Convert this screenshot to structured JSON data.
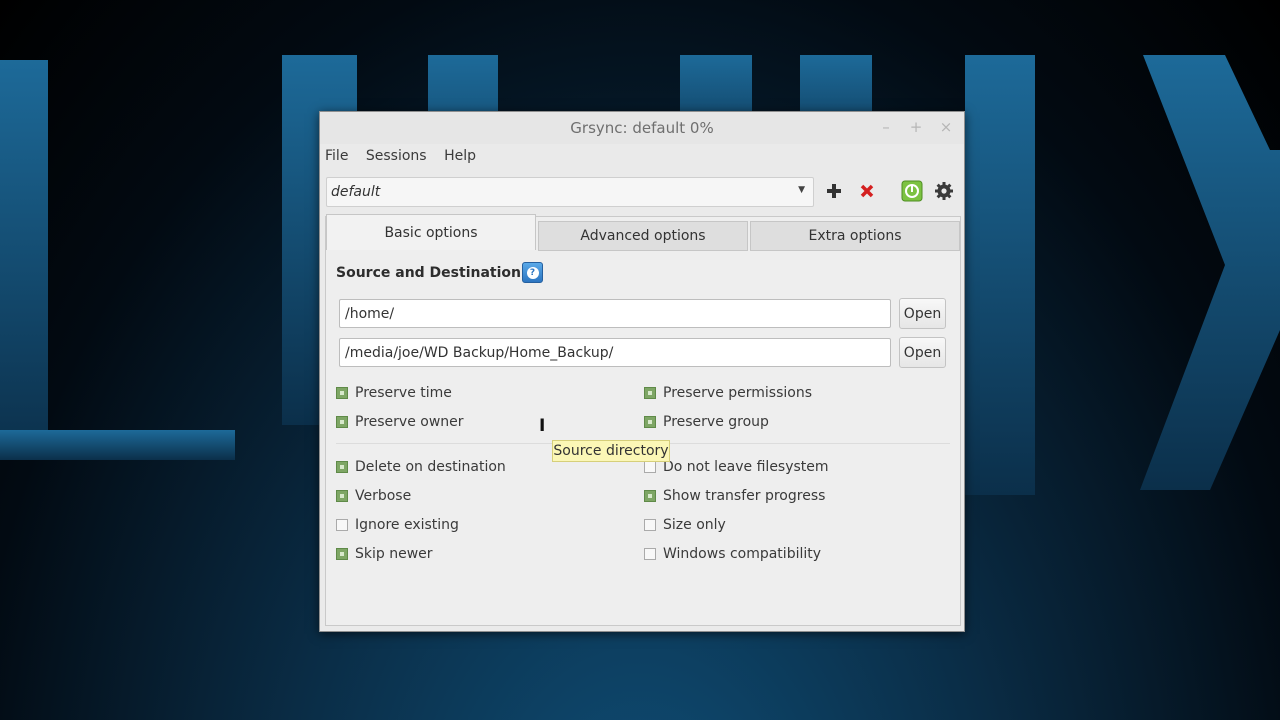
{
  "window": {
    "title": "Grsync: default 0%",
    "controls": {
      "minimize": "–",
      "maximize": "+",
      "close": "×"
    }
  },
  "menu": [
    "File",
    "Sessions",
    "Help"
  ],
  "session": {
    "value": "default"
  },
  "toolbar": {
    "add_icon": "plus-icon",
    "delete_icon": "red-x-icon",
    "run_icon": "run-icon",
    "settings_icon": "gear-icon"
  },
  "tabs": [
    {
      "label": "Basic options",
      "active": true
    },
    {
      "label": "Advanced options",
      "active": false
    },
    {
      "label": "Extra options",
      "active": false
    }
  ],
  "basic": {
    "section_title": "Source and Destination:",
    "source": {
      "value": "/home/",
      "button": "Open"
    },
    "destination": {
      "value": "/media/joe/WD Backup/Home_Backup/",
      "button": "Open"
    },
    "tooltip": "Source directory",
    "group1": [
      {
        "label": "Preserve time",
        "checked": true
      },
      {
        "label": "Preserve permissions",
        "checked": true
      },
      {
        "label": "Preserve owner",
        "checked": true
      },
      {
        "label": "Preserve group",
        "checked": true
      }
    ],
    "group2": [
      {
        "label": "Delete on destination",
        "checked": true
      },
      {
        "label": "Do not leave filesystem",
        "checked": false
      },
      {
        "label": "Verbose",
        "checked": true
      },
      {
        "label": "Show transfer progress",
        "checked": true
      },
      {
        "label": "Ignore existing",
        "checked": false
      },
      {
        "label": "Size only",
        "checked": false
      },
      {
        "label": "Skip newer",
        "checked": true
      },
      {
        "label": "Windows compatibility",
        "checked": false
      }
    ]
  },
  "colors": {
    "check_on": "#7ea665",
    "delete_red": "#d42020",
    "run_green": "#7cc242",
    "help_blue": "#2c75c1"
  }
}
